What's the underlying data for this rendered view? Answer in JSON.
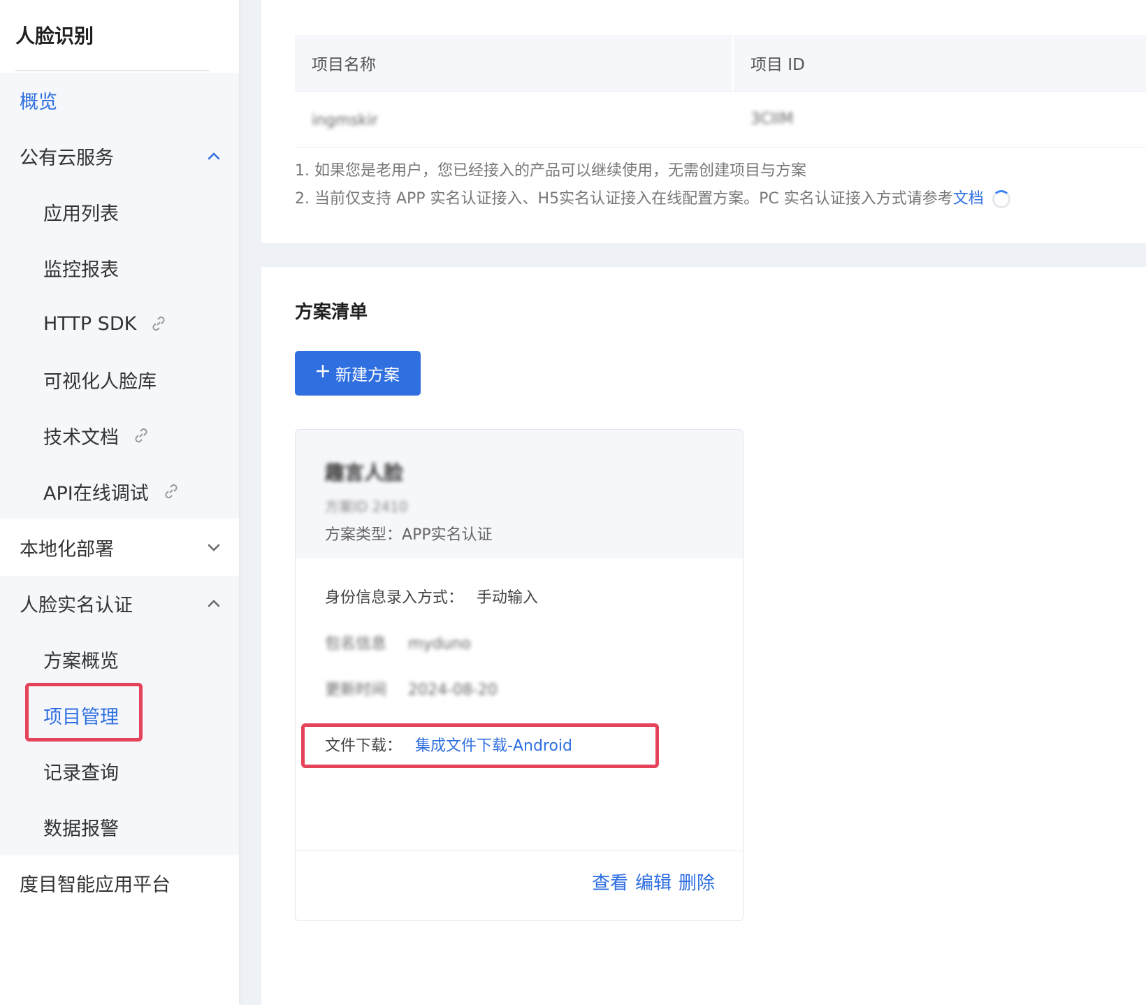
{
  "sidebar": {
    "title": "人脸识别",
    "items": [
      {
        "label": "概览",
        "active": true
      },
      {
        "label": "公有云服务",
        "expanded": true,
        "children": [
          {
            "label": "应用列表"
          },
          {
            "label": "监控报表"
          },
          {
            "label": "HTTP SDK",
            "icon": "link-icon"
          },
          {
            "label": "可视化人脸库"
          },
          {
            "label": "技术文档",
            "icon": "link-icon"
          },
          {
            "label": "API在线调试",
            "icon": "link-icon"
          }
        ]
      },
      {
        "label": "本地化部署",
        "expanded": false
      },
      {
        "label": "人脸实名认证",
        "expanded": true,
        "children": [
          {
            "label": "方案概览"
          },
          {
            "label": "项目管理",
            "active": true
          },
          {
            "label": "记录查询"
          },
          {
            "label": "数据报警"
          }
        ]
      },
      {
        "label": "度目智能应用平台"
      }
    ]
  },
  "project_table": {
    "columns": [
      "项目名称",
      "项目 ID"
    ],
    "rows": [
      [
        "ingmskir",
        "3CIIM"
      ]
    ]
  },
  "notes": {
    "line1": "1. 如果您是老用户，您已经接入的产品可以继续使用，无需创建项目与方案",
    "line2_prefix": "2. 当前仅支持 APP 实名认证接入、H5实名认证接入在线配置方案。PC 实名认证接入方式请参考",
    "line2_link": "文档"
  },
  "plan_list": {
    "title": "方案清单",
    "new_button": "新建方案",
    "card": {
      "name": "趣言人脸",
      "sub": "方案ID 2410",
      "type_label": "方案类型：",
      "type_value": "APP实名认证",
      "input_label": "身份信息录入方式：",
      "input_value": "手动输入",
      "blur_row1_label": "包名信息",
      "blur_row1_value": "myduno",
      "blur_row2_label": "更新时间",
      "blur_row2_value": "2024-08-20",
      "file_label": "文件下载：",
      "file_link": "集成文件下载-Android",
      "actions": [
        "查看",
        "编辑",
        "删除"
      ]
    }
  },
  "colors": {
    "accent": "#2f6fe0",
    "highlight": "#e5435a"
  }
}
